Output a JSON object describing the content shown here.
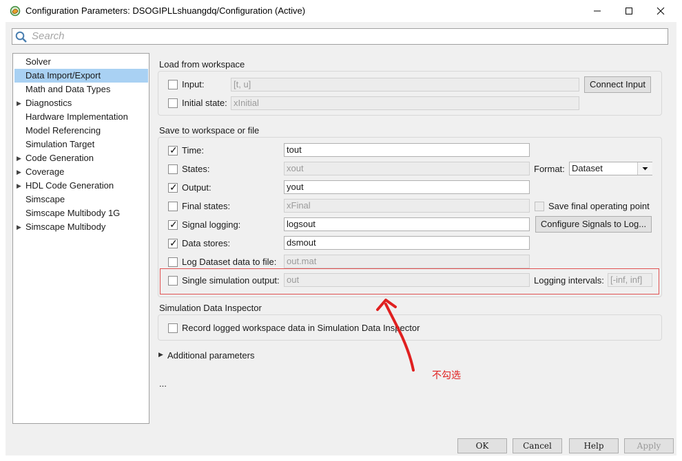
{
  "window": {
    "title": "Configuration Parameters: DSOGIPLLshuangdq/Configuration (Active)",
    "minimize_glyph": "—",
    "maximize_glyph": "☐",
    "close_glyph": "✕"
  },
  "search": {
    "placeholder": "Search"
  },
  "sidebar": {
    "items": [
      {
        "label": "Solver",
        "expandable": false,
        "selected": false
      },
      {
        "label": "Data Import/Export",
        "expandable": false,
        "selected": true
      },
      {
        "label": "Math and Data Types",
        "expandable": false,
        "selected": false
      },
      {
        "label": "Diagnostics",
        "expandable": true,
        "selected": false
      },
      {
        "label": "Hardware Implementation",
        "expandable": false,
        "selected": false
      },
      {
        "label": "Model Referencing",
        "expandable": false,
        "selected": false
      },
      {
        "label": "Simulation Target",
        "expandable": false,
        "selected": false
      },
      {
        "label": "Code Generation",
        "expandable": true,
        "selected": false
      },
      {
        "label": "Coverage",
        "expandable": true,
        "selected": false
      },
      {
        "label": "HDL Code Generation",
        "expandable": true,
        "selected": false
      },
      {
        "label": "Simscape",
        "expandable": false,
        "selected": false
      },
      {
        "label": "Simscape Multibody 1G",
        "expandable": false,
        "selected": false
      },
      {
        "label": "Simscape Multibody",
        "expandable": true,
        "selected": false
      }
    ]
  },
  "load": {
    "title": "Load from workspace",
    "input": {
      "label": "Input:",
      "checked": false,
      "value": "[t, u]"
    },
    "initial_state": {
      "label": "Initial state:",
      "checked": false,
      "value": "xInitial"
    },
    "connect_button": "Connect Input"
  },
  "save": {
    "title": "Save to workspace or file",
    "time": {
      "label": "Time:",
      "checked": true,
      "value": "tout"
    },
    "states": {
      "label": "States:",
      "checked": false,
      "value": "xout"
    },
    "output": {
      "label": "Output:",
      "checked": true,
      "value": "yout"
    },
    "final_states": {
      "label": "Final states:",
      "checked": false,
      "value": "xFinal"
    },
    "signal_logging": {
      "label": "Signal logging:",
      "checked": true,
      "value": "logsout"
    },
    "data_stores": {
      "label": "Data stores:",
      "checked": true,
      "value": "dsmout"
    },
    "log_dataset": {
      "label": "Log Dataset data to file:",
      "checked": false,
      "value": "out.mat"
    },
    "single_output": {
      "label": "Single simulation output:",
      "checked": false,
      "value": "out"
    },
    "format_label": "Format:",
    "format_value": "Dataset",
    "save_final_op": {
      "label": "Save final operating point",
      "checked": false
    },
    "configure_button": "Configure Signals to Log...",
    "logging_intervals_label": "Logging intervals:",
    "logging_intervals_value": "[-inf, inf]"
  },
  "sdi": {
    "title": "Simulation Data Inspector",
    "record": {
      "label": "Record logged workspace data in Simulation Data Inspector",
      "checked": false
    }
  },
  "additional": {
    "label": "Additional parameters"
  },
  "ellipsis": "...",
  "annotation": {
    "text": "不勾选",
    "color": "#e02020"
  },
  "bottom_buttons": {
    "ok": "OK",
    "cancel": "Cancel",
    "help": "Help",
    "apply": "Apply"
  },
  "colors": {
    "selection": "#a9d1f3",
    "annotation_red": "#e05050"
  }
}
